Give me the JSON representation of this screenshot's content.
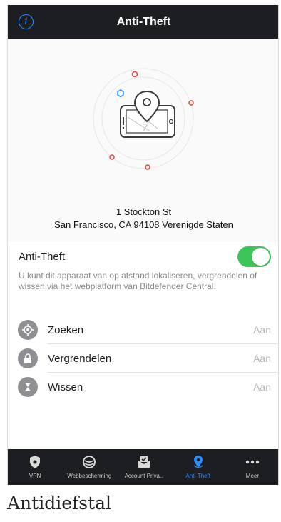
{
  "header": {
    "title": "Anti-Theft",
    "info_icon": "info-icon"
  },
  "location": {
    "street": "1 Stockton St",
    "city_line": "San Francisco, CA  94108 Verenigde Staten"
  },
  "toggle": {
    "label": "Anti-Theft",
    "enabled": true
  },
  "description": "U kunt dit apparaat van op afstand lokaliseren, vergrendelen of wissen via het webplatform van Bitdefender Central.",
  "actions": [
    {
      "label": "Zoeken",
      "value": "Aan",
      "icon": "locate-icon"
    },
    {
      "label": "Vergrendelen",
      "value": "Aan",
      "icon": "lock-icon"
    },
    {
      "label": "Wissen",
      "value": "Aan",
      "icon": "wipe-icon"
    }
  ],
  "tabs": [
    {
      "label": "VPN",
      "icon": "vpn-shield-icon",
      "active": false
    },
    {
      "label": "Webbescherming",
      "icon": "web-protection-icon",
      "active": false
    },
    {
      "label": "Account Priva..",
      "icon": "account-privacy-icon",
      "active": false
    },
    {
      "label": "Anti-Theft",
      "icon": "anti-theft-pin-icon",
      "active": true
    },
    {
      "label": "Meer",
      "icon": "more-dots-icon",
      "active": false
    }
  ],
  "caption": "Antidiefstal",
  "colors": {
    "header_bg": "#1c1e21",
    "accent_blue": "#2f8cff",
    "toggle_green": "#3dc55a",
    "marker_red": "#e2463c"
  }
}
